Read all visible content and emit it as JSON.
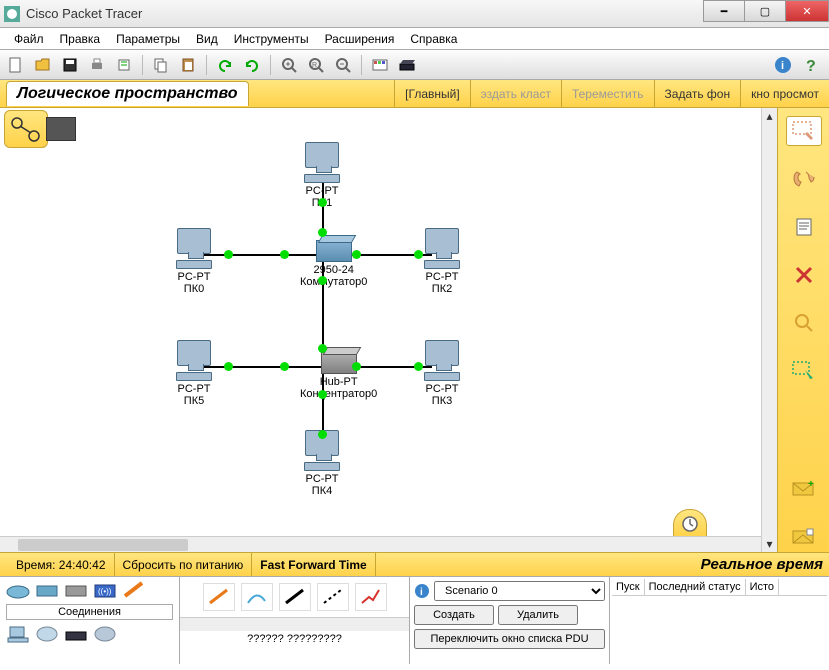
{
  "window": {
    "title": "Cisco Packet Tracer"
  },
  "menu": [
    "Файл",
    "Правка",
    "Параметры",
    "Вид",
    "Инструменты",
    "Расширения",
    "Справка"
  ],
  "tabbar": {
    "main": "Логическое пространство",
    "crumbs": [
      {
        "label": "[Главный]",
        "disabled": false
      },
      {
        "label": "эздать класт",
        "disabled": true
      },
      {
        "label": "Тереместить",
        "disabled": true
      },
      {
        "label": "Задать фон",
        "disabled": false
      },
      {
        "label": "кно просмот",
        "disabled": false
      }
    ]
  },
  "devices": {
    "pc0": {
      "type": "PC-PT",
      "name": "ПК0"
    },
    "pc1": {
      "type": "PC-PT",
      "name": "ПК1"
    },
    "pc2": {
      "type": "PC-PT",
      "name": "ПК2"
    },
    "pc3": {
      "type": "PC-PT",
      "name": "ПК3"
    },
    "pc4": {
      "type": "PC-PT",
      "name": "ПК4"
    },
    "pc5": {
      "type": "PC-PT",
      "name": "ПК5"
    },
    "sw0": {
      "type": "2950-24",
      "name": "Коммутатор0"
    },
    "hub0": {
      "type": "Hub-PT",
      "name": "Концентратор0"
    }
  },
  "status": {
    "time_label": "Время:",
    "time": "24:40:42",
    "reset": "Сбросить по питанию",
    "fft": "Fast Forward Time",
    "realtime": "Реальное время"
  },
  "devpanel": {
    "label": "Соединения"
  },
  "connpanel": {
    "label": "?????? ?????????"
  },
  "scenario": {
    "label": "Scenario 0",
    "create": "Создать",
    "delete": "Удалить",
    "toggle": "Переключить окно списка PDU"
  },
  "pdu": {
    "c1": "Пуск",
    "c2": "Последний статус",
    "c3": "Исто"
  }
}
